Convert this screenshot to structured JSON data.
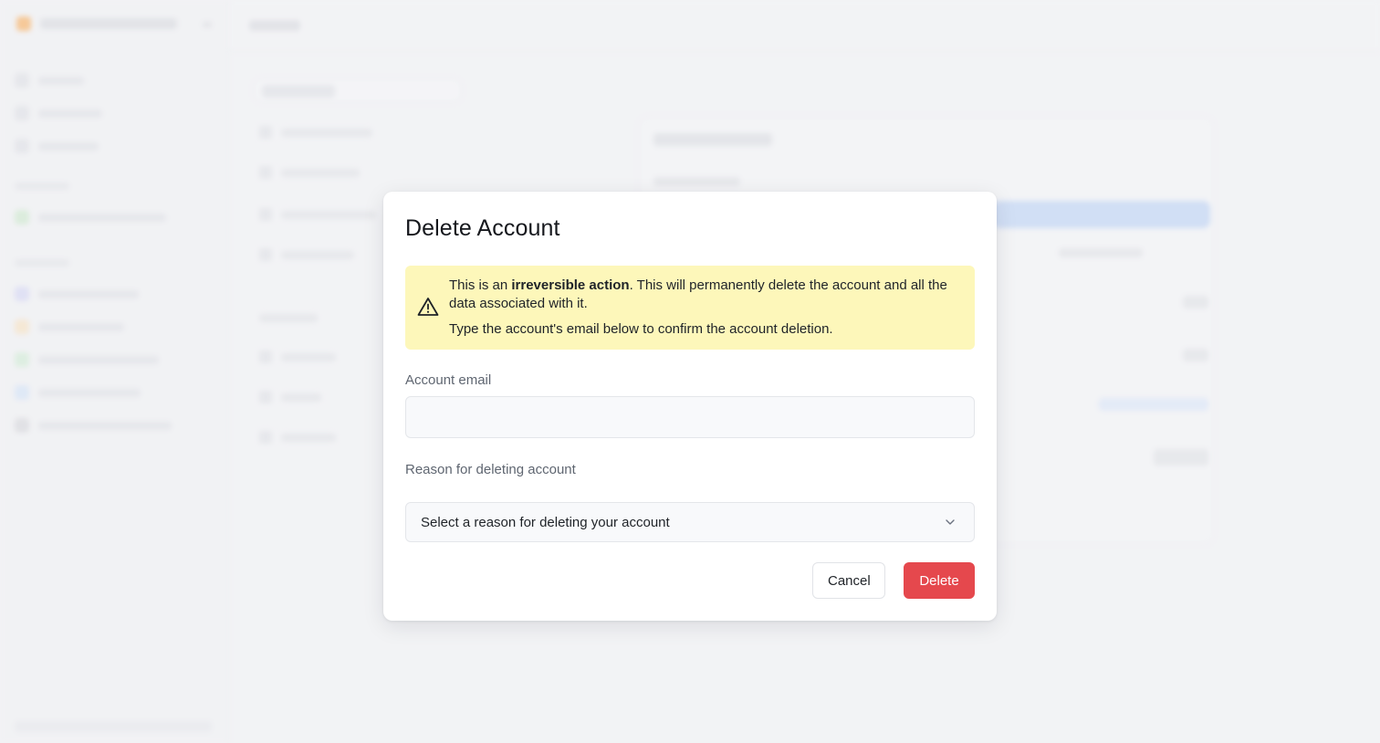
{
  "modal": {
    "title": "Delete Account",
    "warning": {
      "line1_prefix": "This is an ",
      "line1_bold": "irreversible action",
      "line1_suffix": ". This will permanently delete the account and all the data associated with it.",
      "line2": "Type the account's email below to confirm the account deletion."
    },
    "email_label": "Account email",
    "email_value": "",
    "reason_label": "Reason for deleting account",
    "reason_selected": "Select a reason for deleting your account",
    "cancel_label": "Cancel",
    "delete_label": "Delete"
  },
  "colors": {
    "danger": "#e5484d",
    "warning_bg": "#fdf7ba",
    "background": "#f2f3f5"
  },
  "icons": {
    "warning": "warning-triangle-icon",
    "select_chevron": "chevron-down-icon"
  }
}
